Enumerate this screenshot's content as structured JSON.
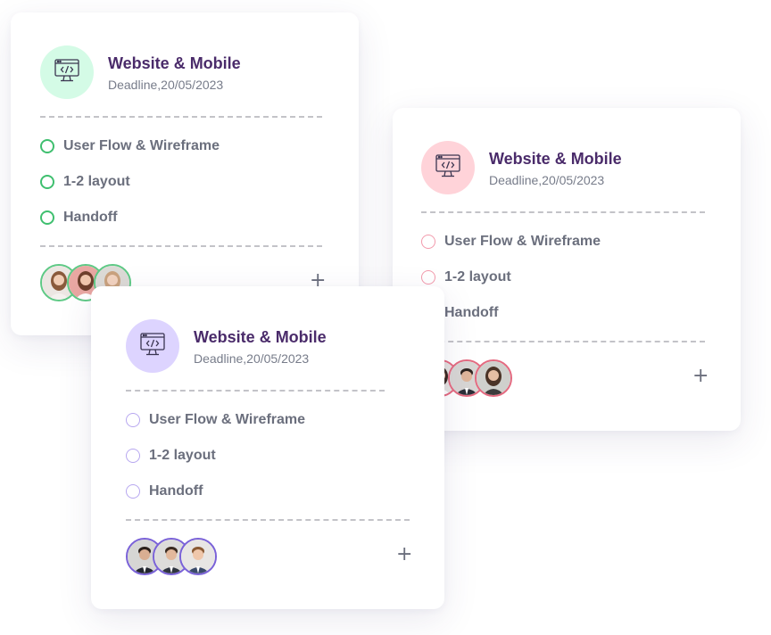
{
  "colors": {
    "title": "#4a2b6a",
    "text": "#6b6f7d",
    "muted": "#777c8a",
    "green": "#3fbf6f",
    "green_bg": "#d4fbe6",
    "pink": "#f29aac",
    "pink_bg": "#ffd3d9",
    "purple": "#b7a7f0",
    "purple_bg": "#ddd4ff"
  },
  "cards": [
    {
      "theme": "green",
      "icon": "code-monitor-icon",
      "title": "Website & Mobile",
      "deadline": "Deadline,20/05/2023",
      "tasks": [
        "User Flow & Wireframe",
        "1-2 layout",
        "Handoff"
      ],
      "add_label": "+"
    },
    {
      "theme": "pink",
      "icon": "code-monitor-icon",
      "title": "Website & Mobile",
      "deadline": "Deadline,20/05/2023",
      "tasks": [
        "User Flow & Wireframe",
        "1-2 layout",
        "Handoff"
      ],
      "add_label": "+"
    },
    {
      "theme": "purple",
      "icon": "code-monitor-icon",
      "title": "Website & Mobile",
      "deadline": "Deadline,20/05/2023",
      "tasks": [
        "User Flow & Wireframe",
        "1-2 layout",
        "Handoff"
      ],
      "add_label": "+"
    }
  ]
}
